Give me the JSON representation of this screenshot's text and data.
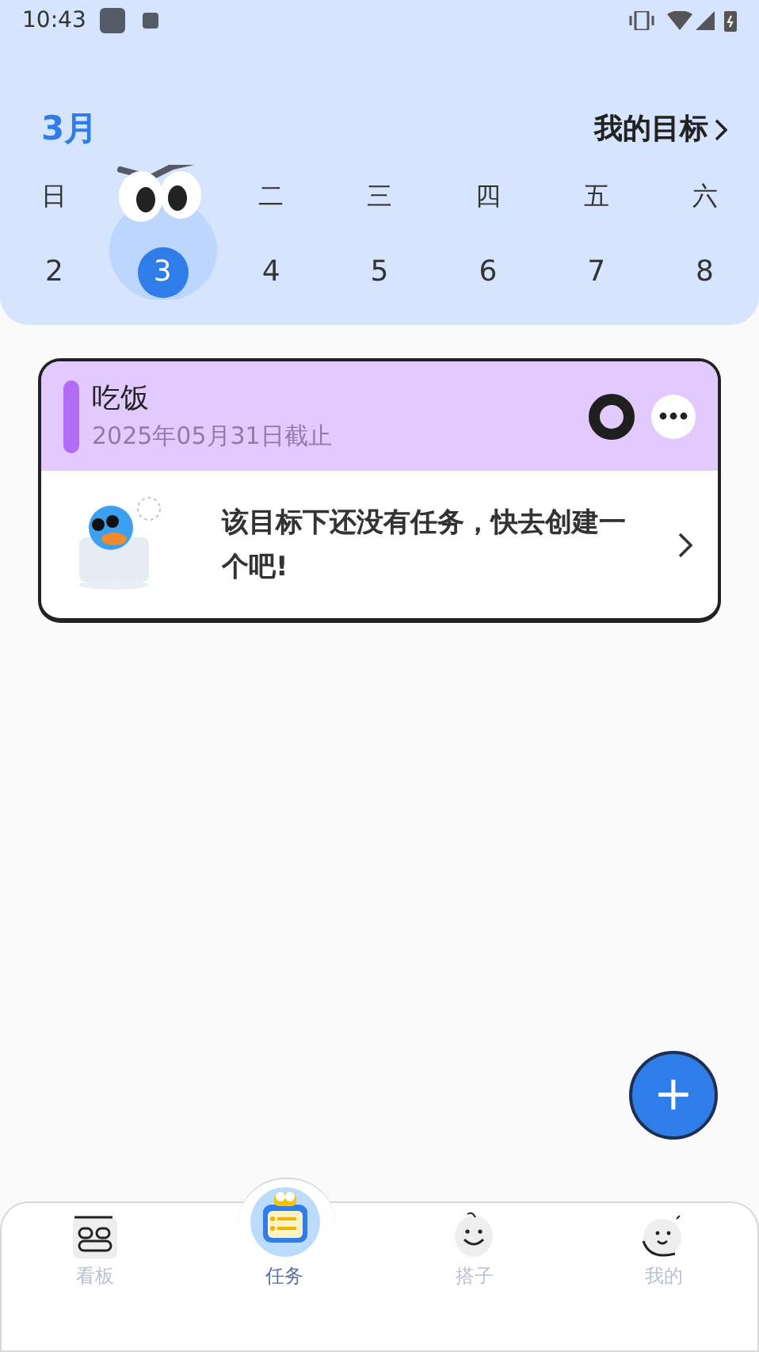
{
  "status_bar": {
    "time": "10:43"
  },
  "header": {
    "month": "3月",
    "goals_link": "我的目标",
    "days": [
      {
        "weekday": "日",
        "date": "2",
        "selected": false
      },
      {
        "date": "3",
        "selected": true
      },
      {
        "weekday": "二",
        "date": "4",
        "selected": false
      },
      {
        "weekday": "三",
        "date": "5",
        "selected": false
      },
      {
        "weekday": "四",
        "date": "6",
        "selected": false
      },
      {
        "weekday": "五",
        "date": "7",
        "selected": false
      },
      {
        "weekday": "六",
        "date": "8",
        "selected": false
      }
    ]
  },
  "goals": [
    {
      "title": "吃饭",
      "deadline": "2025年05月31日截止",
      "color": "#b16cf6",
      "empty_message": "该目标下还没有任务，快去创建一个吧!"
    }
  ],
  "fab": {
    "label": "+"
  },
  "bottom_nav": [
    {
      "label": "看板",
      "selected": false
    },
    {
      "label": "任务",
      "selected": true
    },
    {
      "label": "搭子",
      "selected": false
    },
    {
      "label": "我的",
      "selected": false
    }
  ]
}
